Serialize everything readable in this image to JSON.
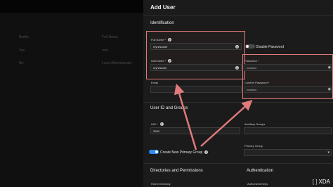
{
  "background": {
    "table_headers": [
      "Builtin",
      "Full Name"
    ],
    "rows": [
      {
        "builtin": "Yes",
        "full_name": "root"
      },
      {
        "builtin": "No",
        "full_name": "Local Administrator"
      }
    ]
  },
  "panel": {
    "title": "Add User",
    "identification": {
      "heading": "Identification",
      "full_name_label": "Full Name *",
      "full_name_value": "mynewuser",
      "username_label": "Username *",
      "username_value": "mynewuse",
      "email_label": "Email",
      "email_value": "",
      "disable_password_label": "Disable Password",
      "disable_password_on": false,
      "password_label": "Password *",
      "password_value": "••••••••••",
      "confirm_password_label": "Confirm Password *",
      "confirm_password_value": "••••••••••"
    },
    "userid_groups": {
      "heading": "User ID and Groups",
      "uid_label": "UID *",
      "uid_value": "3000",
      "auxiliary_groups_label": "Auxiliary Groups",
      "primary_group_label": "Primary Group",
      "create_primary_group_label": "Create New Primary Group",
      "create_primary_group_on": true
    },
    "directories_heading": "Directories and Permissions",
    "home_directory_label": "Home Directory",
    "authentication_heading": "Authentication",
    "authorized_keys_label": "Authorized Keys"
  },
  "watermark": {
    "brand": "XDA"
  },
  "colors": {
    "highlight": "#e07a7a",
    "toggle_on": "#2d8cf0",
    "panel_bg": "#1b1b1b"
  },
  "icons": [
    "help-icon",
    "clear-icon",
    "eye-icon",
    "dropdown-arrow-icon"
  ]
}
